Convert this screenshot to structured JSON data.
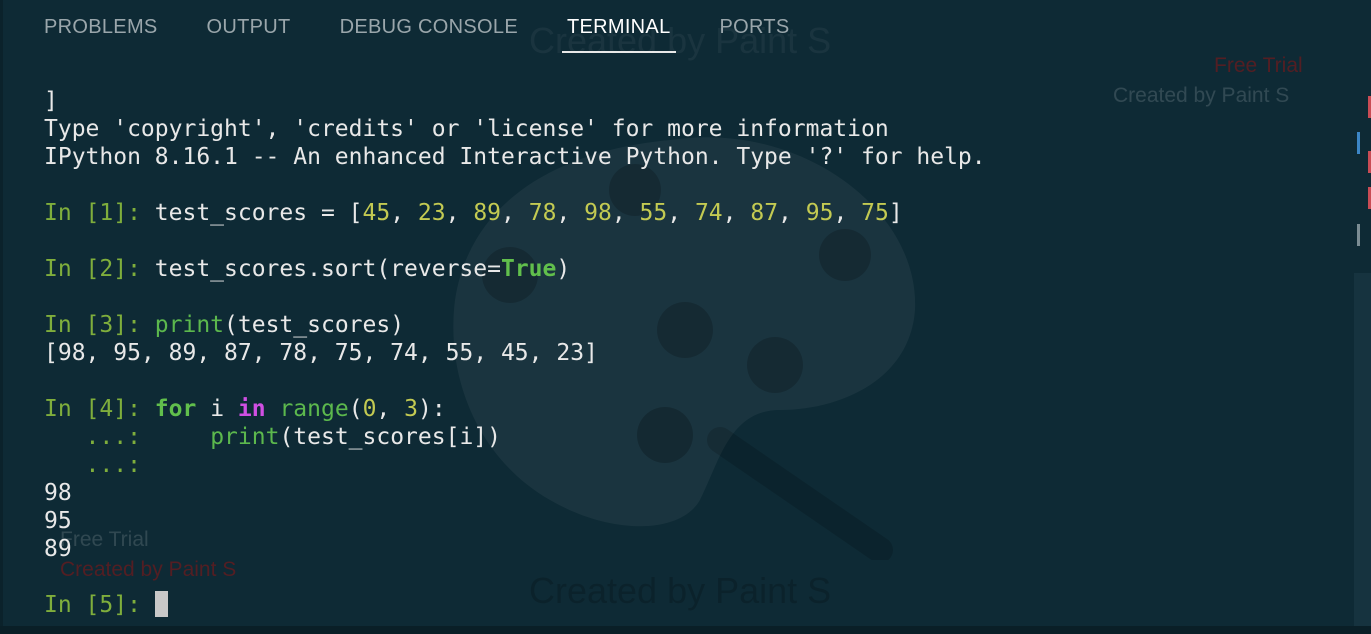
{
  "tabs": [
    {
      "label": "PROBLEMS",
      "active": false
    },
    {
      "label": "OUTPUT",
      "active": false
    },
    {
      "label": "DEBUG CONSOLE",
      "active": false
    },
    {
      "label": "TERMINAL",
      "active": true
    },
    {
      "label": "PORTS",
      "active": false
    }
  ],
  "terminal": {
    "bracket_line": "]",
    "info_line1": "Type 'copyright', 'credits' or 'license' for more information",
    "info_line2": "IPython 8.16.1 -- An enhanced Interactive Python. Type '?' for help.",
    "cell1": {
      "prompt": "In [1]:",
      "pre": " test_scores = [",
      "nums": [
        "45",
        "23",
        "89",
        "78",
        "98",
        "55",
        "74",
        "87",
        "95",
        "75"
      ],
      "post": "]"
    },
    "cell2": {
      "prompt": "In [2]:",
      "pre": " test_scores.sort(reverse=",
      "kw": "True",
      "post": ")"
    },
    "cell3": {
      "prompt": "In [3]:",
      "fn": "print",
      "post": "(test_scores)",
      "output": "[98, 95, 89, 87, 78, 75, 74, 55, 45, 23]"
    },
    "cell4": {
      "prompt": "In [4]:",
      "kw_for": "for",
      "var": " i ",
      "kw_in": "in",
      "fn_range": "range",
      "open": "(",
      "n0": "0",
      "sep": ", ",
      "n3": "3",
      "close": "):",
      "cont1": "   ...:",
      "indent": "     ",
      "fn_print": "print",
      "body": "(test_scores[i])",
      "cont2": "   ...:",
      "outputs": [
        "98",
        "95",
        "89"
      ]
    },
    "cell5": {
      "prompt": "In [5]:"
    }
  },
  "watermark": {
    "main": "Created by Paint S",
    "free_trial": "Free Trial",
    "small": "Created by Paint S"
  },
  "colors": {
    "background": "#0e2a35",
    "prompt": "#7fae3c",
    "number": "#c3ca52",
    "keyword": "#61bf4c",
    "in_keyword": "#d04fe3"
  }
}
